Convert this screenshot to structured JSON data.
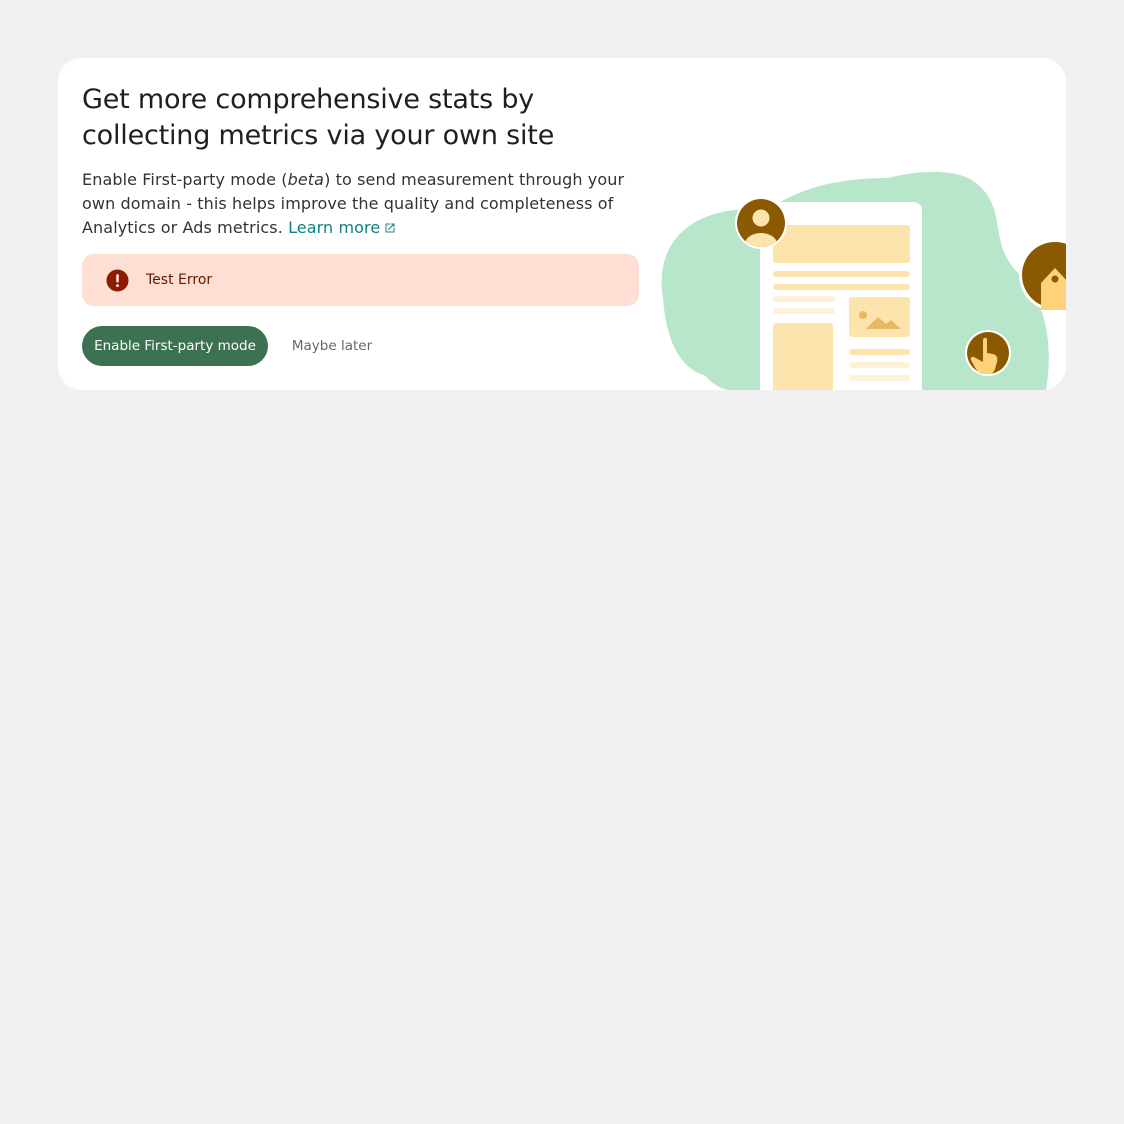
{
  "banner": {
    "title": "Get more comprehensive stats by collecting metrics via your own site",
    "description": {
      "part1": "Enable First-party mode (",
      "beta": "beta",
      "part2": ") to send measurement through your own domain - this helps improve the quality and completeness of Analytics or Ads metrics.",
      "learn_more_label": "Learn more",
      "learn_more_icon": "external-link-icon"
    },
    "error": {
      "icon": "error-icon",
      "message": "Test Error"
    },
    "actions": {
      "primary_label": "Enable First-party mode",
      "secondary_label": "Maybe later"
    },
    "illustration": {
      "icons": [
        "user-avatar-icon",
        "pointer-hand-icon",
        "tag-icon",
        "image-icon"
      ]
    }
  },
  "colors": {
    "page_background": "#f1f1f1",
    "card_background": "#ffffff",
    "primary_button": "#3c7251",
    "link": "#108080",
    "error_background": "#ffded3",
    "error_icon": "#8c1d00",
    "illustration_green": "#b8e6cb",
    "illustration_yellow": "#fde4ad",
    "illustration_brown": "#8b5a00"
  }
}
